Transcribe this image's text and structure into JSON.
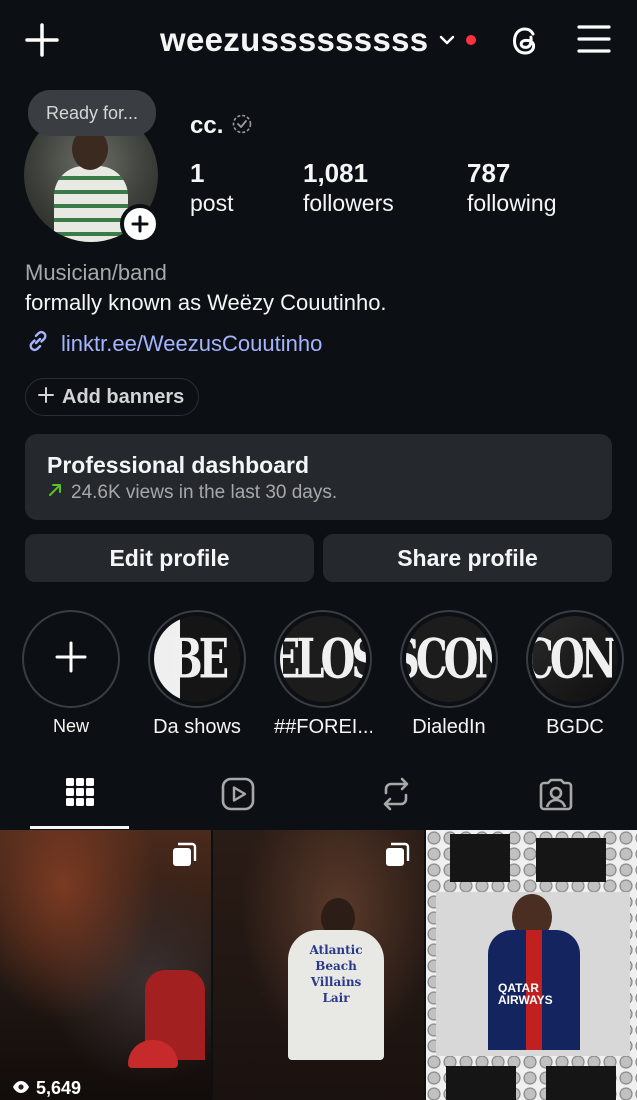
{
  "header": {
    "username": "weezusssssssss",
    "has_notification_dot": true,
    "icons": [
      "plus-icon",
      "chevron-down-icon",
      "threads-icon",
      "hamburger-menu-icon"
    ]
  },
  "profile": {
    "note": "Ready for...",
    "display_name": "cc.",
    "stats": [
      {
        "value": "1",
        "label": "post"
      },
      {
        "value": "1,081",
        "label": "followers"
      },
      {
        "value": "787",
        "label": "following"
      }
    ],
    "category": "Musician/band",
    "bio": "formally known as Weëzy Couutinho.",
    "link": "linktr.ee/WeezusCouutinho",
    "add_banners": "Add banners"
  },
  "dashboard": {
    "title": "Professional dashboard",
    "subtitle": "24.6K views in the last 30 days.",
    "trend_color": "#58c322"
  },
  "buttons": {
    "edit": "Edit profile",
    "share": "Share profile"
  },
  "highlights": [
    {
      "label": "New",
      "cover": ""
    },
    {
      "label": "Da shows",
      "cover": "BE"
    },
    {
      "label": "##FOREI...",
      "cover": "ELOS"
    },
    {
      "label": "DialedIn",
      "cover": "SCON"
    },
    {
      "label": "BGDC",
      "cover": "CONI"
    }
  ],
  "tabs": [
    "grid-icon",
    "reels-icon",
    "reposts-icon",
    "tagged-icon"
  ],
  "posts": [
    {
      "type": "carousel",
      "views": "5,649"
    },
    {
      "type": "carousel",
      "print": "Atlantic Beach Villains Lair"
    },
    {
      "type": "image",
      "print": "QATAR AIRWAYS"
    }
  ],
  "colors": {
    "background": "#0c1014",
    "card": "#25292e",
    "link": "#a6b4ff",
    "notification": "#ff3040"
  }
}
